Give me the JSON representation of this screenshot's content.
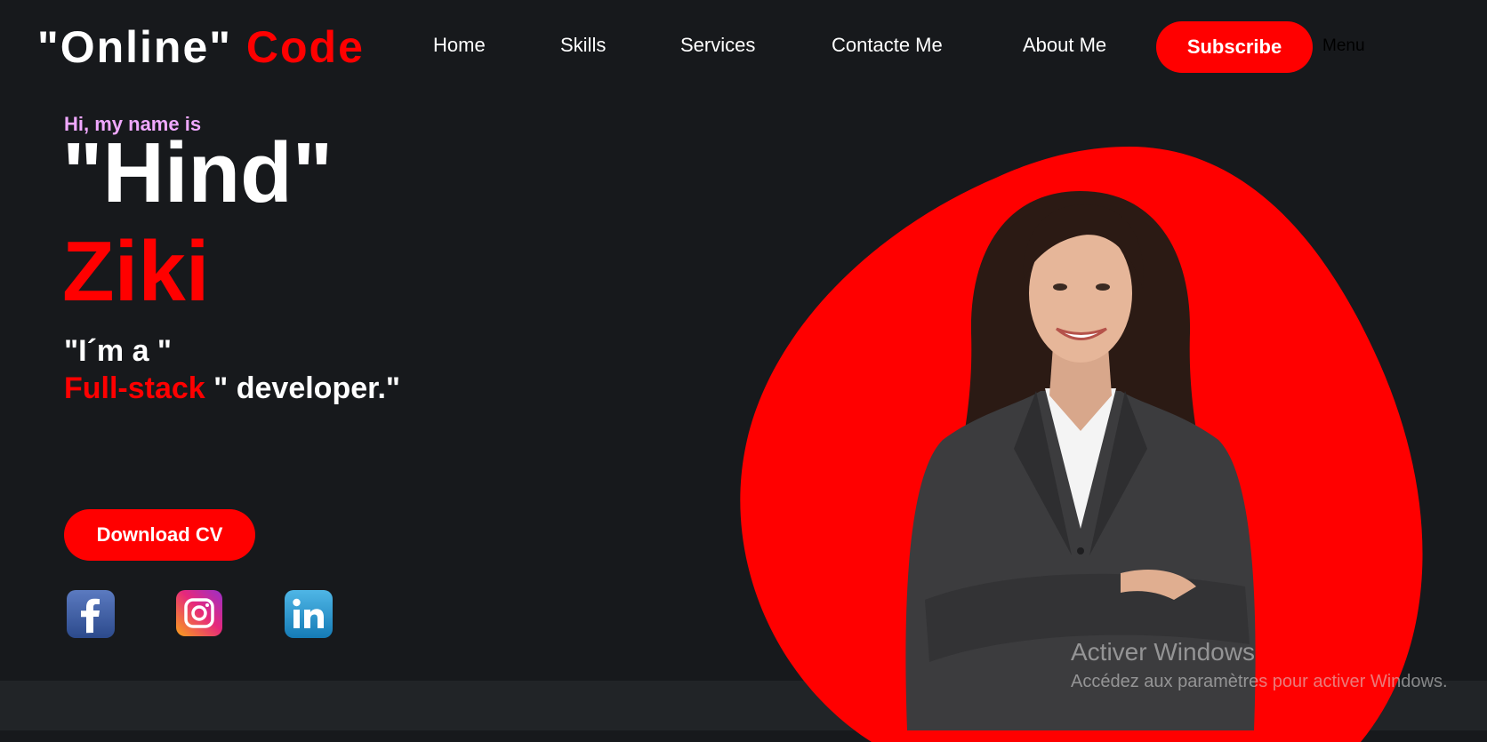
{
  "header": {
    "logo_part1": "\"Online\"",
    "logo_part2": "Code",
    "nav": [
      "Home",
      "Skills",
      "Services",
      "Contacte Me",
      "About Me"
    ],
    "subscribe_label": "Subscribe",
    "menu_label": "Menu"
  },
  "hero": {
    "greeting": "Hi, my name is",
    "first_name": "\"Hind\"",
    "last_name": "Ziki",
    "role_line1": "\"I´m a \"",
    "role_highlight": "Full-stack",
    "role_rest": " \" developer.\"",
    "download_label": "Download CV"
  },
  "social": {
    "icons": [
      "facebook-icon",
      "instagram-icon",
      "linkedin-icon"
    ]
  },
  "watermark": {
    "title": "Activer Windows",
    "subtitle": "Accédez aux paramètres pour activer Windows."
  },
  "colors": {
    "background": "#17191c",
    "accent": "#ff0000",
    "greeting": "#f0a8ff",
    "bottom_band": "#212427"
  }
}
